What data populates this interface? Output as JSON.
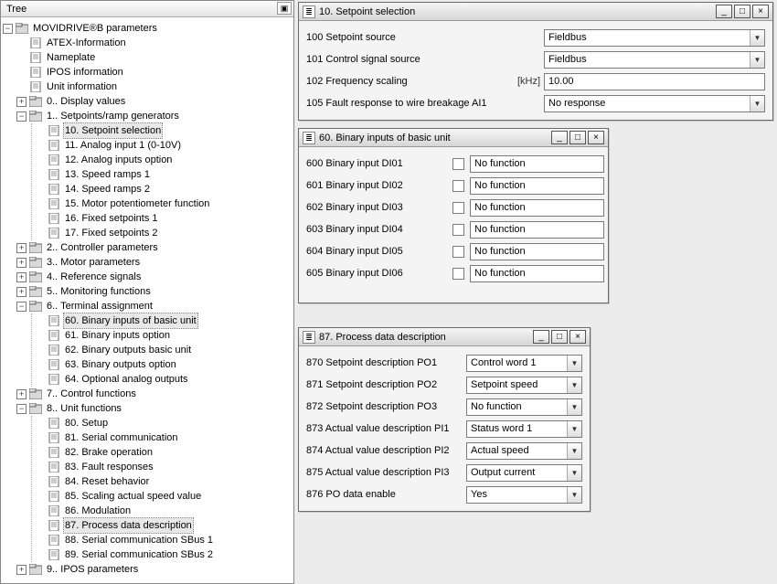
{
  "treeTitle": "Tree",
  "rootLabel": "MOVIDRIVE®B parameters",
  "tree": [
    {
      "label": "ATEX-Information",
      "icon": "page"
    },
    {
      "label": "Nameplate",
      "icon": "page"
    },
    {
      "label": "IPOS information",
      "icon": "page"
    },
    {
      "label": "Unit information",
      "icon": "page"
    },
    {
      "label": "0.. Display values",
      "icon": "folder",
      "twist": "+"
    },
    {
      "label": "1.. Setpoints/ramp generators",
      "icon": "folder",
      "twist": "-",
      "children": [
        {
          "label": "10. Setpoint selection",
          "sel": true
        },
        {
          "label": "11. Analog input 1 (0-10V)"
        },
        {
          "label": "12. Analog inputs option"
        },
        {
          "label": "13. Speed ramps 1"
        },
        {
          "label": "14. Speed ramps 2"
        },
        {
          "label": "15. Motor potentiometer function"
        },
        {
          "label": "16. Fixed setpoints 1"
        },
        {
          "label": "17. Fixed setpoints 2"
        }
      ]
    },
    {
      "label": "2.. Controller parameters",
      "icon": "folder",
      "twist": "+"
    },
    {
      "label": "3.. Motor parameters",
      "icon": "folder",
      "twist": "+"
    },
    {
      "label": "4.. Reference signals",
      "icon": "folder",
      "twist": "+"
    },
    {
      "label": "5.. Monitoring functions",
      "icon": "folder",
      "twist": "+"
    },
    {
      "label": "6.. Terminal assignment",
      "icon": "folder",
      "twist": "-",
      "children": [
        {
          "label": "60. Binary inputs of basic unit",
          "sel": true
        },
        {
          "label": "61. Binary inputs option"
        },
        {
          "label": "62. Binary outputs basic unit"
        },
        {
          "label": "63. Binary outputs option"
        },
        {
          "label": "64. Optional analog outputs"
        }
      ]
    },
    {
      "label": "7.. Control functions",
      "icon": "folder",
      "twist": "+"
    },
    {
      "label": "8.. Unit functions",
      "icon": "folder",
      "twist": "-",
      "children": [
        {
          "label": "80. Setup"
        },
        {
          "label": "81. Serial communication"
        },
        {
          "label": "82. Brake operation"
        },
        {
          "label": "83. Fault responses"
        },
        {
          "label": "84. Reset behavior"
        },
        {
          "label": "85. Scaling actual speed value"
        },
        {
          "label": "86. Modulation"
        },
        {
          "label": "87. Process data description",
          "sel": true
        },
        {
          "label": "88. Serial communication SBus 1"
        },
        {
          "label": "89. Serial communication SBus 2"
        }
      ]
    },
    {
      "label": "9.. IPOS parameters",
      "icon": "folder",
      "twist": "+"
    }
  ],
  "win10": {
    "title": "10. Setpoint selection",
    "rows": [
      {
        "label": "100 Setpoint source",
        "type": "combo",
        "value": "Fieldbus"
      },
      {
        "label": "101 Control signal source",
        "type": "combo",
        "value": "Fieldbus"
      },
      {
        "label": "102 Frequency scaling",
        "type": "text",
        "unit": "[kHz]",
        "value": "10.00"
      },
      {
        "label": "105 Fault response to wire breakage AI1",
        "type": "combo",
        "value": "No response"
      }
    ]
  },
  "win60": {
    "title": "60. Binary inputs of basic unit",
    "rows": [
      {
        "label": "600 Binary input DI01",
        "value": "No function"
      },
      {
        "label": "601 Binary input DI02",
        "value": "No function"
      },
      {
        "label": "602 Binary input DI03",
        "value": "No function"
      },
      {
        "label": "603 Binary input DI04",
        "value": "No function"
      },
      {
        "label": "604 Binary input DI05",
        "value": "No function"
      },
      {
        "label": "605 Binary input DI06",
        "value": "No function"
      }
    ]
  },
  "win87": {
    "title": "87. Process data description",
    "rows": [
      {
        "label": "870 Setpoint description PO1",
        "value": "Control word 1"
      },
      {
        "label": "871 Setpoint description PO2",
        "value": "Setpoint speed"
      },
      {
        "label": "872 Setpoint description PO3",
        "value": "No function"
      },
      {
        "label": "873 Actual value description PI1",
        "value": "Status word 1"
      },
      {
        "label": "874 Actual value description PI2",
        "value": "Actual speed"
      },
      {
        "label": "875 Actual value description PI3",
        "value": "Output current"
      },
      {
        "label": "876 PO data enable",
        "value": "Yes"
      }
    ]
  },
  "winButtons": {
    "min": "_",
    "max": "□",
    "close": "×"
  }
}
